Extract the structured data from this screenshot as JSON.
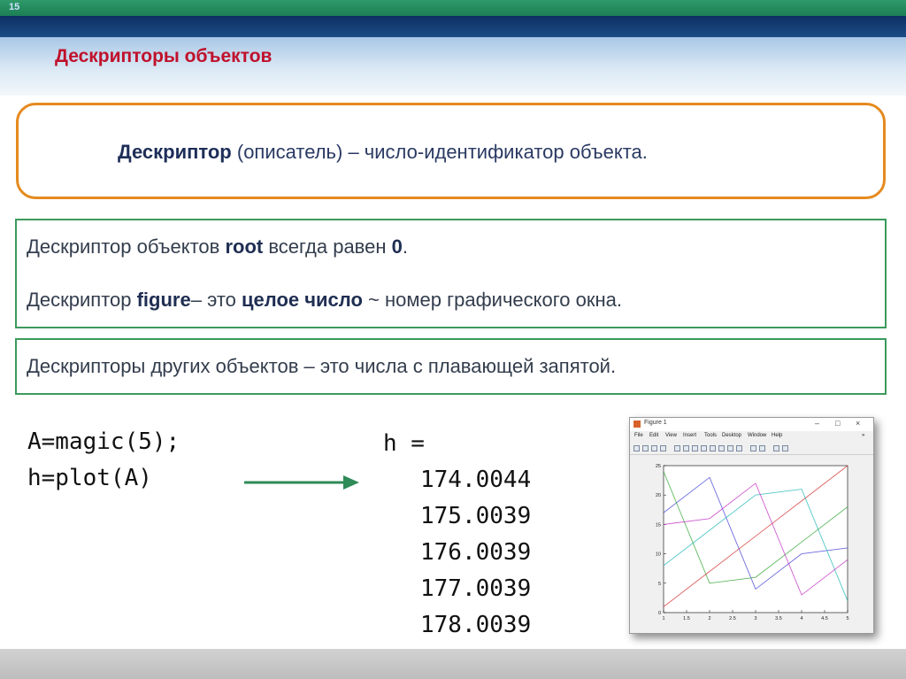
{
  "slide": {
    "number": "15",
    "title": "Дескрипторы объектов"
  },
  "definition": {
    "term": "Дескриптор",
    "rest": " (описатель) – число-идентификатор объекта."
  },
  "box2": {
    "line1": {
      "t1": "Дескриптор объектов ",
      "b1": "root",
      "t2": " всегда равен ",
      "b2": "0",
      "t3": "."
    },
    "line2": {
      "t1": "Дескриптор  ",
      "b1": "figure",
      "t2": "– это ",
      "b2": "целое число",
      "t3": " ~ номер графического окна."
    }
  },
  "box3": {
    "text": "Дескрипторы других объектов – это числа с плавающей запятой."
  },
  "code": {
    "line1": "A=magic(5);",
    "line2": "h=plot(A)"
  },
  "output": {
    "label": "h =",
    "values": [
      "174.0044",
      "175.0039",
      "176.0039",
      "177.0039",
      "178.0039"
    ]
  },
  "figure_window": {
    "title": "Figure 1",
    "controls": {
      "minimize": "–",
      "maximize": "□",
      "close": "×",
      "chevron": "»"
    },
    "menu": [
      "File",
      "Edit",
      "View",
      "Insert",
      "Tools",
      "Desktop",
      "Window",
      "Help"
    ]
  },
  "chart_data": {
    "type": "line",
    "x": [
      1,
      2,
      3,
      4,
      5
    ],
    "xticks": [
      "1",
      "1.5",
      "2",
      "2.5",
      "3",
      "3.5",
      "4",
      "4.5",
      "5"
    ],
    "yticks": [
      "0",
      "5",
      "10",
      "15",
      "20",
      "25"
    ],
    "xlim": [
      1,
      5
    ],
    "ylim": [
      0,
      25
    ],
    "series": [
      {
        "values": [
          17,
          23,
          4,
          10,
          11
        ],
        "color": "#3b3bd6"
      },
      {
        "values": [
          24,
          5,
          6,
          12,
          18
        ],
        "color": "#2aa22a"
      },
      {
        "values": [
          1,
          7,
          13,
          19,
          25
        ],
        "color": "#d12a2a"
      },
      {
        "values": [
          8,
          14,
          20,
          21,
          2
        ],
        "color": "#19b3b3"
      },
      {
        "values": [
          15,
          16,
          22,
          3,
          9
        ],
        "color": "#c02ac0"
      }
    ]
  }
}
